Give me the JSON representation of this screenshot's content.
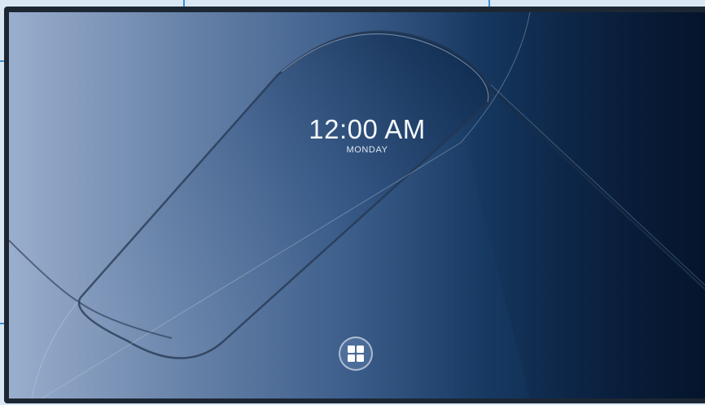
{
  "lock_screen": {
    "time": "12:00 AM",
    "day": "MONDAY"
  },
  "taskbar": {
    "start_icon": "windows-grid-icon"
  },
  "colors": {
    "guide_marker": "#3d8fd6",
    "outer_background": "#d9e6f3",
    "bezel": "#1d2733",
    "wallpaper_light": "#9aaecd",
    "wallpaper_dark": "#07182f",
    "text": "#f4f7fb"
  }
}
